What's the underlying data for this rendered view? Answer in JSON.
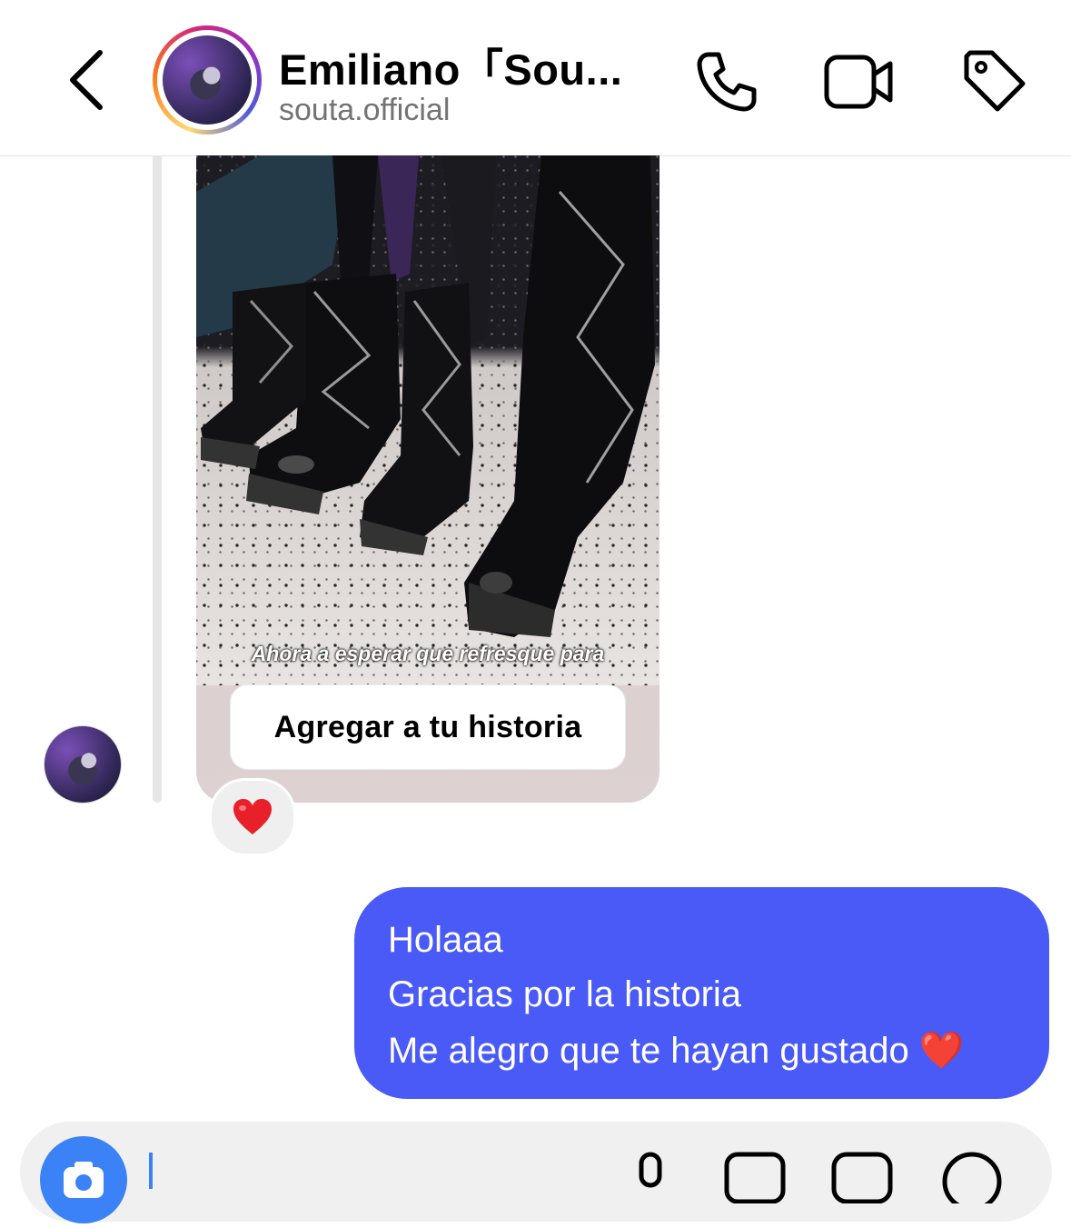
{
  "header": {
    "title": "Emiliano「Sou...",
    "subtitle": "souta.official",
    "icons": [
      "back-chevron-icon",
      "phone-icon",
      "video-camera-icon",
      "tag-icon"
    ]
  },
  "thread": {
    "story_reply": {
      "caption": "Ahora a esperar que refresque para",
      "add_to_story_label": "Agregar a tu historia",
      "reaction": "❤️"
    },
    "sent_message": {
      "lines": [
        "Holaaa",
        "Gracias por la historia",
        "Me alegro que te hayan gustado ❤️"
      ],
      "bubble_color": "#4a5af7"
    }
  },
  "composer": {
    "icons": [
      "camera-icon",
      "microphone-icon",
      "gallery-icon",
      "sticker-icon",
      "add-icon"
    ]
  }
}
